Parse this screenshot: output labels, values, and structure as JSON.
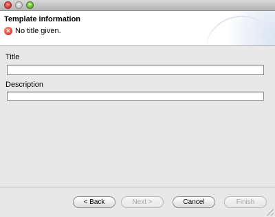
{
  "window": {
    "controls": {
      "close_icon": "close-icon",
      "minimize_icon": "minimize-icon",
      "maximize_icon": "maximize-icon"
    }
  },
  "header": {
    "title": "Template information",
    "message": "No title given.",
    "message_icon": "error-icon",
    "message_icon_glyph": "✕"
  },
  "form": {
    "title_label": "Title",
    "title_value": "",
    "description_label": "Description",
    "description_value": ""
  },
  "buttons": {
    "back": "< Back",
    "next": "Next >",
    "cancel": "Cancel",
    "finish": "Finish"
  },
  "colors": {
    "error": "#e0463a",
    "separator": "#a9a9a9"
  }
}
